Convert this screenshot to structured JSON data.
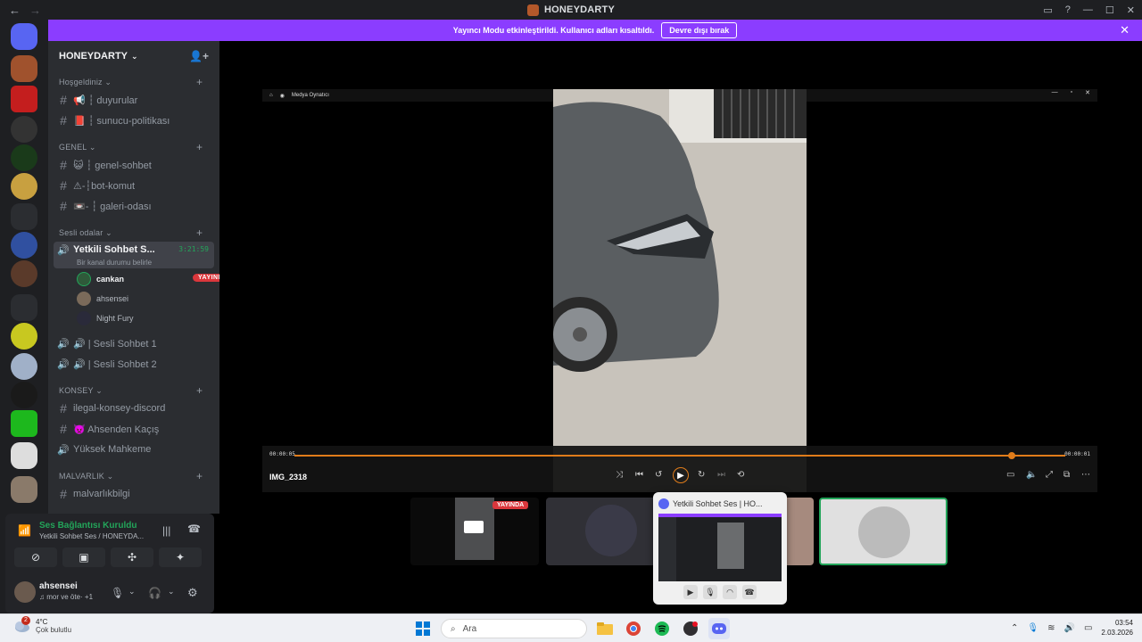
{
  "window": {
    "title": "HONEYDARTY",
    "back": "←",
    "forward": "→",
    "controls": [
      "—",
      "☐",
      "✕"
    ]
  },
  "banner": {
    "text": "Yayıncı Modu etkinleştirildi. Kullanıcı adları kısaltıldı.",
    "button": "Devre dışı bırak",
    "close": "✕"
  },
  "sidebar": {
    "server_name": "HONEYDARTY",
    "categories": [
      {
        "name": "Hoşgeldiniz"
      },
      {
        "name": "GENEL"
      },
      {
        "name": "Sesli odalar"
      },
      {
        "name": "KONSEY"
      },
      {
        "name": "MALVARLIK"
      }
    ],
    "channels": [
      {
        "icon": "#",
        "label": "📢 ┆ duyurular"
      },
      {
        "icon": "#",
        "label": "📕 ┆ sunucu-politikası"
      },
      {
        "icon": "#",
        "label": "😺 ┆ genel-sohbet"
      },
      {
        "icon": "#",
        "label": "⚠-┆bot-komut"
      },
      {
        "icon": "#",
        "label": "📼- ┆ galeri-odası"
      },
      {
        "icon": "🔊",
        "label": "Yetkili Sohbet S...",
        "timer": "3:21:59",
        "status": "Bir kanal durumu belirle"
      },
      {
        "icon": "🔊",
        "label": "🔊 | Sesli Sohbet 1"
      },
      {
        "icon": "🔊",
        "label": "🔊 | Sesli Sohbet 2"
      },
      {
        "icon": "#",
        "label": "ilegal-konsey-discord"
      },
      {
        "icon": "#",
        "label": "👿 Ahsenden Kaçış"
      },
      {
        "icon": "🔊",
        "label": "Yüksek Mahkeme"
      },
      {
        "icon": "#",
        "label": "malvarlıkbilgi"
      }
    ],
    "voice_users": [
      {
        "name": "cankan",
        "live": "YAYINDA"
      },
      {
        "name": "ahsensei"
      },
      {
        "name": "Night Fury"
      }
    ]
  },
  "voice_panel": {
    "status": "Ses Bağlantısı Kuruldu",
    "channel": "Yetkili Sohbet Ses / HONEYDA...",
    "username": "ahsensei",
    "user_status": "♫ mor ve öte· +1"
  },
  "player": {
    "app_name": "Medya Oynatıcı",
    "time_elapsed": "00:00:05",
    "time_total": "00:00:01",
    "filename": "IMG_2318",
    "progress": 0.93
  },
  "thumbs": {
    "live": "YAYINDA"
  },
  "popup": {
    "title": "Yetkili Sohbet Ses | HO..."
  },
  "taskbar": {
    "temperature": "4°C",
    "condition": "Çok bulutlu",
    "notif_count": "2",
    "search_placeholder": "Ara",
    "time": "03:54",
    "date": "2.03.2026"
  },
  "colors": {
    "accent": "#8b3dff",
    "discord_blurple": "#5865f2",
    "connected_green": "#23a55a",
    "live_red": "#da373c",
    "player_orange": "#e07c1a"
  }
}
